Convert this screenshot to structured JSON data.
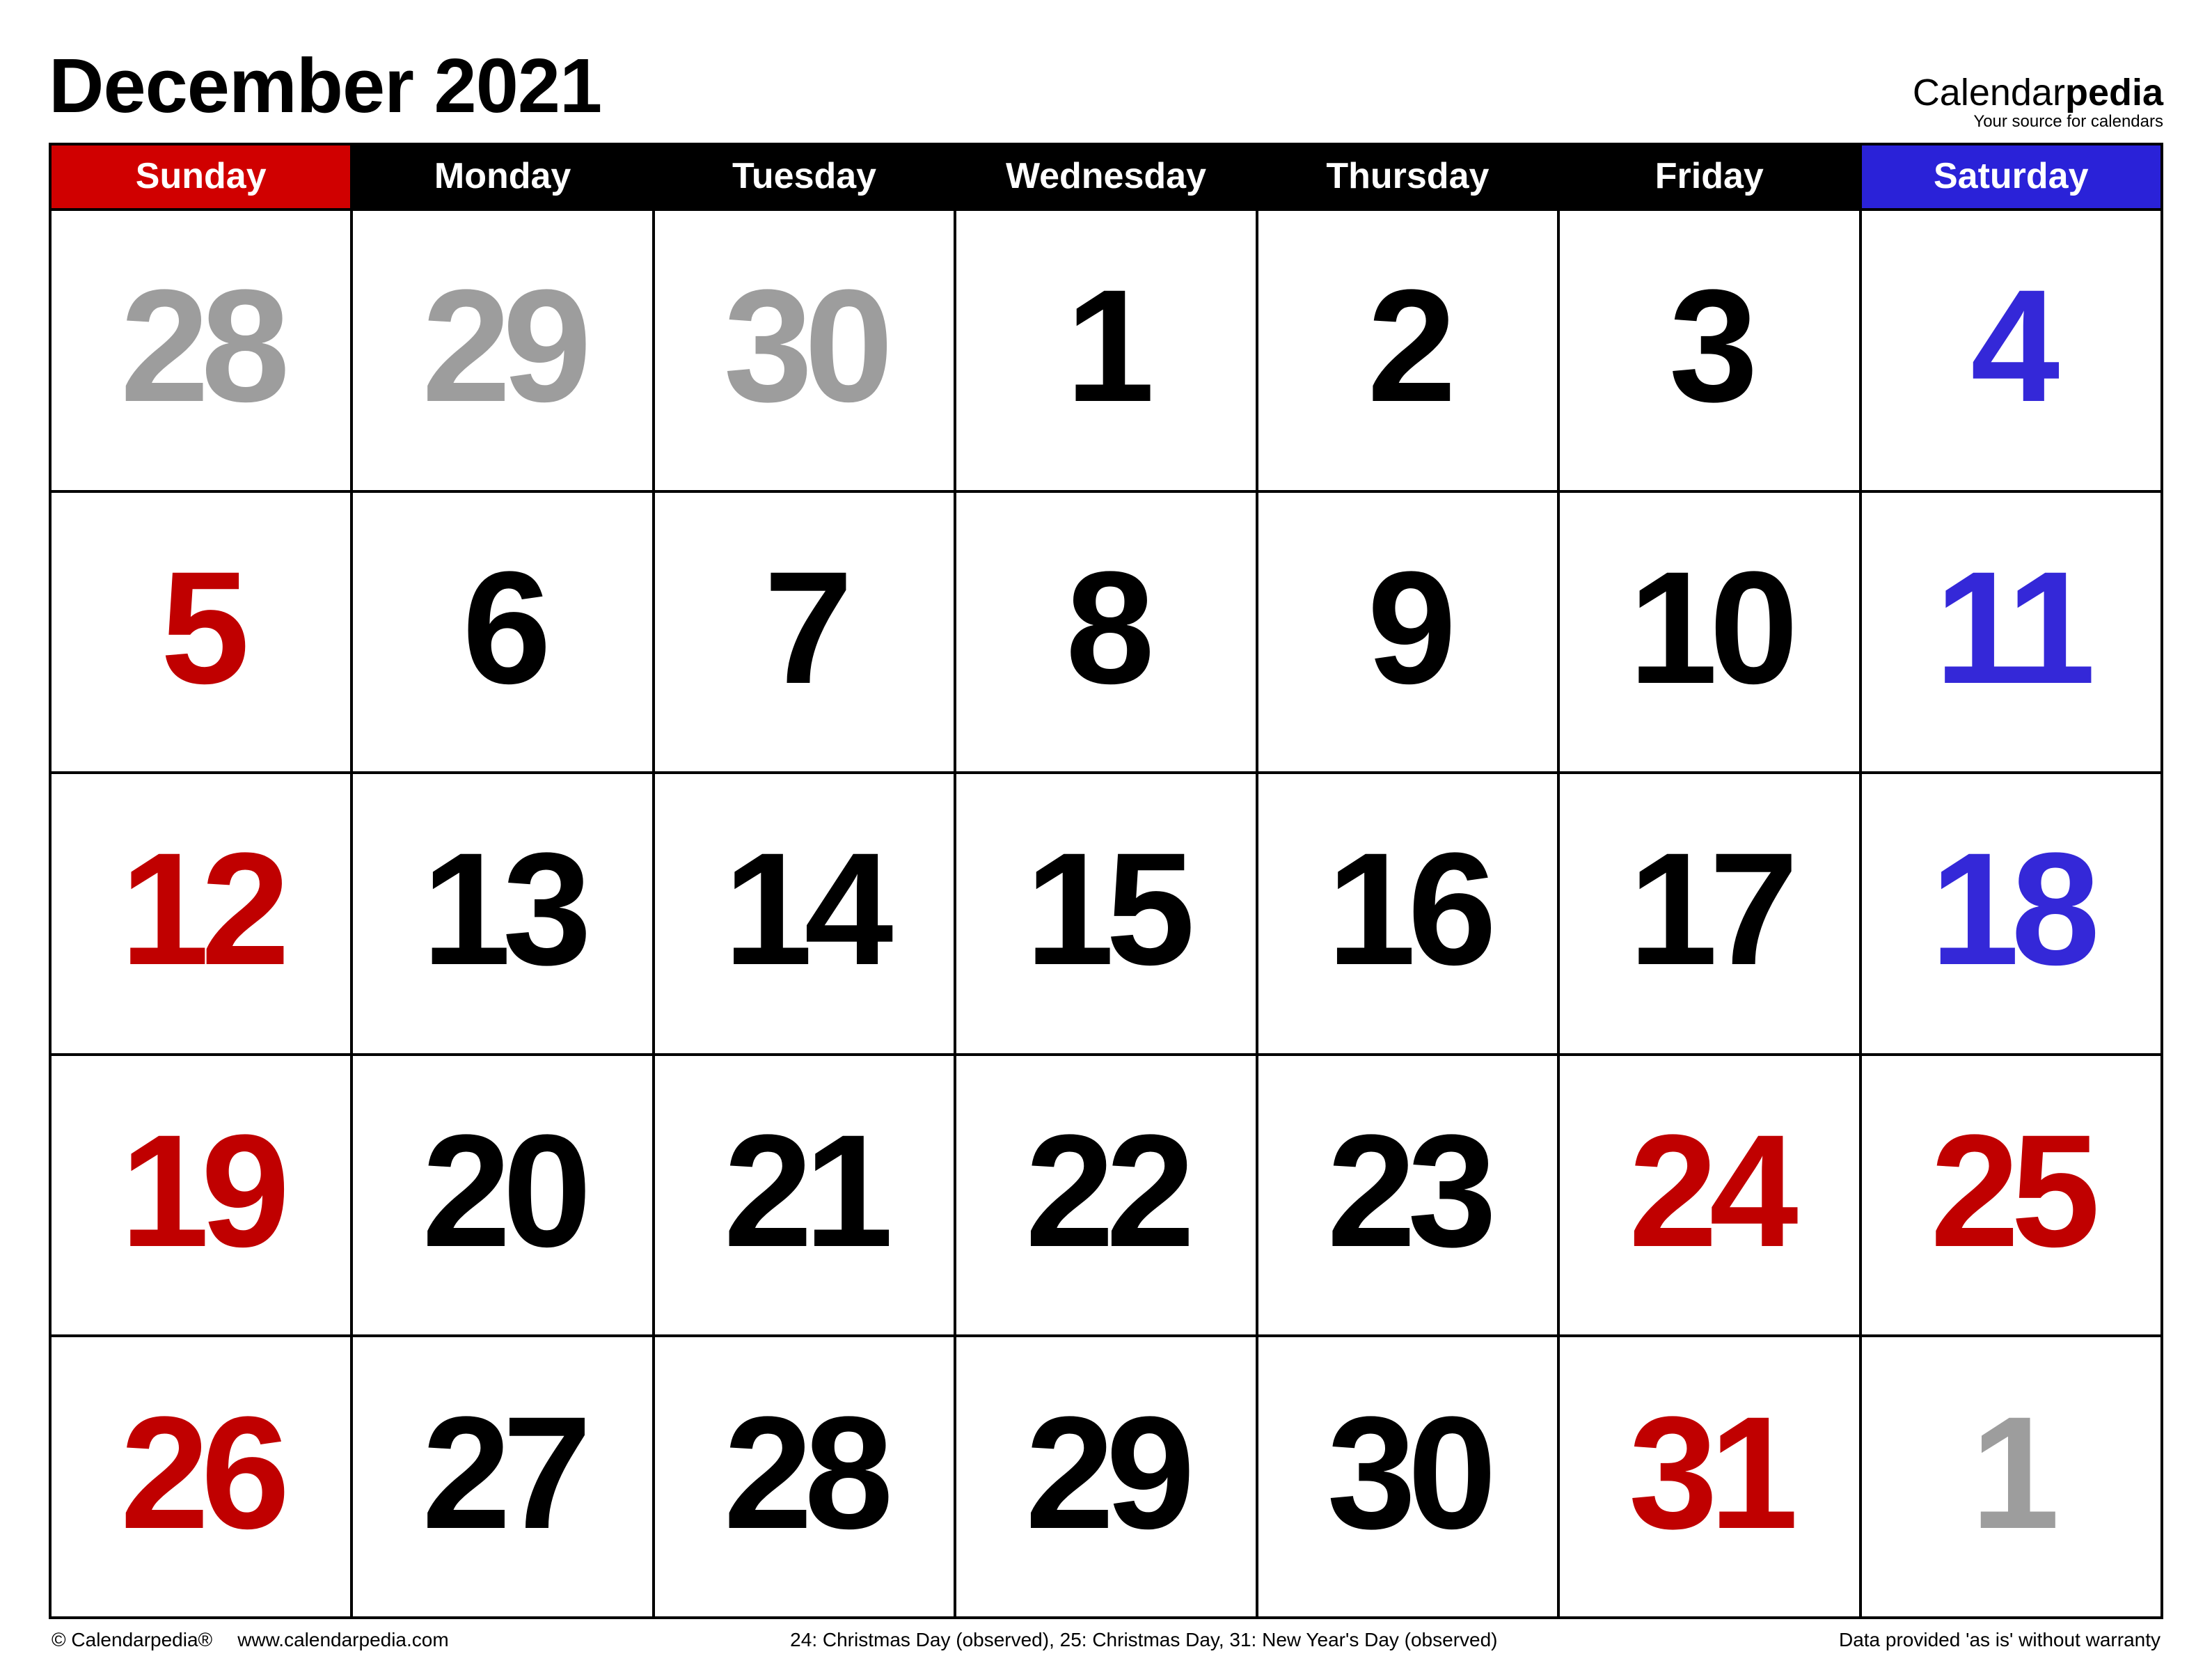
{
  "header": {
    "title": "December 2021",
    "brand_prefix": "Calendar",
    "brand_suffix": "pedia",
    "brand_tagline": "Your source for calendars"
  },
  "days": {
    "sun": "Sunday",
    "mon": "Monday",
    "tue": "Tuesday",
    "wed": "Wednesday",
    "thu": "Thursday",
    "fri": "Friday",
    "sat": "Saturday"
  },
  "weeks": [
    [
      {
        "n": "28",
        "style": "grey"
      },
      {
        "n": "29",
        "style": "grey"
      },
      {
        "n": "30",
        "style": "grey"
      },
      {
        "n": "1",
        "style": "black"
      },
      {
        "n": "2",
        "style": "black"
      },
      {
        "n": "3",
        "style": "black"
      },
      {
        "n": "4",
        "style": "blue"
      }
    ],
    [
      {
        "n": "5",
        "style": "red"
      },
      {
        "n": "6",
        "style": "black"
      },
      {
        "n": "7",
        "style": "black"
      },
      {
        "n": "8",
        "style": "black"
      },
      {
        "n": "9",
        "style": "black"
      },
      {
        "n": "10",
        "style": "black"
      },
      {
        "n": "11",
        "style": "blue"
      }
    ],
    [
      {
        "n": "12",
        "style": "red"
      },
      {
        "n": "13",
        "style": "black"
      },
      {
        "n": "14",
        "style": "black"
      },
      {
        "n": "15",
        "style": "black"
      },
      {
        "n": "16",
        "style": "black"
      },
      {
        "n": "17",
        "style": "black"
      },
      {
        "n": "18",
        "style": "blue"
      }
    ],
    [
      {
        "n": "19",
        "style": "red"
      },
      {
        "n": "20",
        "style": "black"
      },
      {
        "n": "21",
        "style": "black"
      },
      {
        "n": "22",
        "style": "black"
      },
      {
        "n": "23",
        "style": "black"
      },
      {
        "n": "24",
        "style": "red"
      },
      {
        "n": "25",
        "style": "red"
      }
    ],
    [
      {
        "n": "26",
        "style": "red"
      },
      {
        "n": "27",
        "style": "black"
      },
      {
        "n": "28",
        "style": "black"
      },
      {
        "n": "29",
        "style": "black"
      },
      {
        "n": "30",
        "style": "black"
      },
      {
        "n": "31",
        "style": "red"
      },
      {
        "n": "1",
        "style": "grey"
      }
    ]
  ],
  "footer": {
    "copyright": "© Calendarpedia®",
    "url": "www.calendarpedia.com",
    "holidays": "24: Christmas Day (observed), 25: Christmas Day, 31: New Year's Day (observed)",
    "disclaimer": "Data provided 'as is' without warranty"
  }
}
